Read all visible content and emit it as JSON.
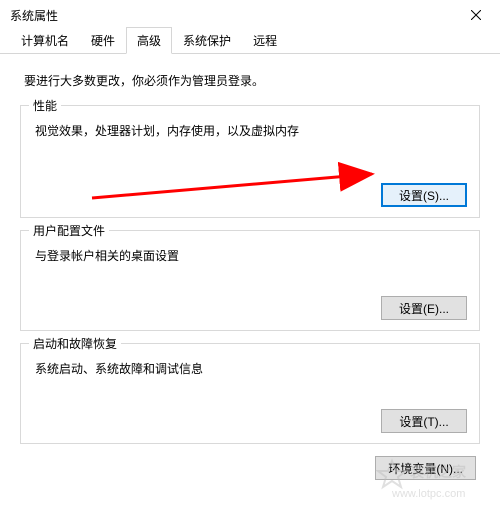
{
  "window": {
    "title": "系统属性",
    "close_icon": "close"
  },
  "tabs": {
    "items": [
      {
        "label": "计算机名",
        "active": false
      },
      {
        "label": "硬件",
        "active": false
      },
      {
        "label": "高级",
        "active": true
      },
      {
        "label": "系统保护",
        "active": false
      },
      {
        "label": "远程",
        "active": false
      }
    ]
  },
  "intro": "要进行大多数更改，你必须作为管理员登录。",
  "groups": {
    "performance": {
      "title": "性能",
      "desc": "视觉效果，处理器计划，内存使用，以及虚拟内存",
      "button": "设置(S)..."
    },
    "userprofile": {
      "title": "用户配置文件",
      "desc": "与登录帐户相关的桌面设置",
      "button": "设置(E)..."
    },
    "startup": {
      "title": "启动和故障恢复",
      "desc": "系统启动、系统故障和调试信息",
      "button": "设置(T)..."
    }
  },
  "footer": {
    "env_button": "环境变量(N)..."
  },
  "watermark": {
    "line1": "装机之家",
    "line2": "www.lotpc.com"
  },
  "colors": {
    "highlight_border": "#0078d7",
    "highlight_bg": "#e5f1fb",
    "arrow": "#ff0000"
  }
}
